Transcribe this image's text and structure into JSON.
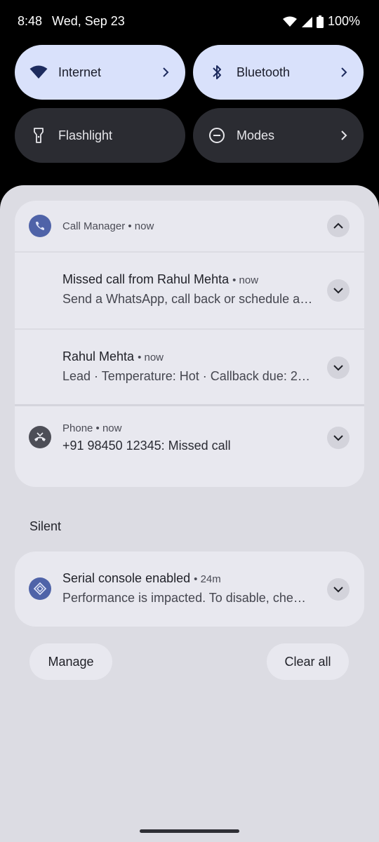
{
  "status_bar": {
    "time": "8:48",
    "date": "Wed, Sep 23",
    "battery": "100%"
  },
  "quick_tiles": [
    {
      "label": "Internet",
      "icon": "wifi-icon",
      "active": true,
      "has_chevron": true
    },
    {
      "label": "Bluetooth",
      "icon": "bluetooth-icon",
      "active": true,
      "has_chevron": true
    },
    {
      "label": "Flashlight",
      "icon": "flashlight-icon",
      "active": false,
      "has_chevron": false
    },
    {
      "label": "Modes",
      "icon": "modes-icon",
      "active": false,
      "has_chevron": true
    }
  ],
  "call_manager_group": {
    "app_name": "Call Manager",
    "time": "• now",
    "icon": "phone-icon",
    "notifications": [
      {
        "title": "Missed call from Rahul Mehta",
        "time": "• now",
        "body": "Send a WhatsApp, call back or schedule a…"
      },
      {
        "title": "Rahul Mehta",
        "time": "• now",
        "body": "Lead · Temperature: Hot · Callback due: 2…"
      }
    ]
  },
  "phone_notification": {
    "app_name": "Phone",
    "time": "• now",
    "icon": "missed-call-icon",
    "body": "+91 98450 12345: Missed call"
  },
  "silent_section": {
    "label": "Silent",
    "notification": {
      "title": "Serial console enabled",
      "time": "• 24m",
      "body": "Performance is impacted. To disable, che…",
      "icon": "system-diamond-icon"
    }
  },
  "footer": {
    "manage_label": "Manage",
    "clear_all_label": "Clear all"
  },
  "colors": {
    "tile_on": "#d9e1fb",
    "tile_off": "#2b2c32",
    "shade_bg": "#dcdce3",
    "card_bg": "#e8e8ef",
    "app_accent": "#4f63a8"
  }
}
